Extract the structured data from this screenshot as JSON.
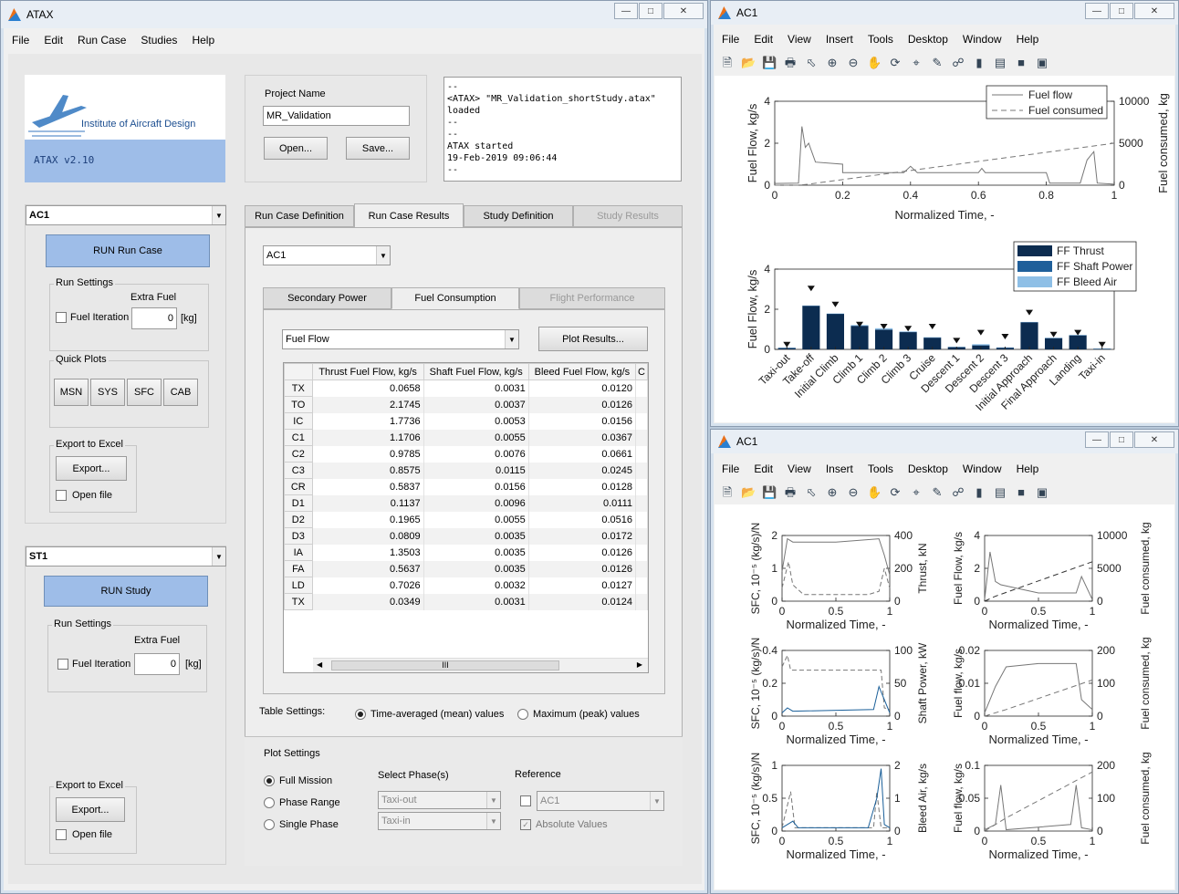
{
  "ataxwin": {
    "title": "ATAX",
    "menu": [
      "File",
      "Edit",
      "Run Case",
      "Studies",
      "Help"
    ],
    "logo_text": "Institute of Aircraft Design",
    "version": "ATAX v2.10",
    "project_label": "Project Name",
    "project_name": "MR_Validation",
    "open_label": "Open...",
    "save_label": "Save...",
    "log": "--\n<ATAX> \"MR_Validation_shortStudy.atax\"\nloaded\n--\n--\nATAX started\n19-Feb-2019 09:06:44\n--",
    "runcase": {
      "select": "AC1",
      "run_label": "RUN Run Case",
      "settings_title": "Run Settings",
      "extra_fuel_label": "Extra Fuel",
      "fuel_iter_label": "Fuel Iteration",
      "extra_fuel_value": "0",
      "unit": "[kg]",
      "quick_title": "Quick Plots",
      "quick": [
        "MSN",
        "SYS",
        "SFC",
        "CAB"
      ],
      "export_title": "Export to Excel",
      "export_label": "Export...",
      "open_file": "Open file"
    },
    "study": {
      "select": "ST1",
      "run_label": "RUN Study",
      "settings_title": "Run Settings",
      "extra_fuel_label": "Extra Fuel",
      "fuel_iter_label": "Fuel Iteration",
      "extra_fuel_value": "0",
      "unit": "[kg]",
      "export_title": "Export to Excel",
      "export_label": "Export...",
      "open_file": "Open file"
    },
    "tabs": [
      "Run Case Definition",
      "Run Case Results",
      "Study Definition",
      "Study Results"
    ],
    "case_select": "AC1",
    "subtabs": [
      "Secondary Power",
      "Fuel Consumption",
      "Flight Performance"
    ],
    "plot_select": "Fuel Flow",
    "plot_results": "Plot Results...",
    "table": {
      "headers": [
        "Thrust Fuel Flow, kg/s",
        "Shaft Fuel Flow, kg/s",
        "Bleed Fuel Flow, kg/s",
        "C"
      ],
      "rows": [
        [
          "TX",
          "0.0658",
          "0.0031",
          "0.0120"
        ],
        [
          "TO",
          "2.1745",
          "0.0037",
          "0.0126"
        ],
        [
          "IC",
          "1.7736",
          "0.0053",
          "0.0156"
        ],
        [
          "C1",
          "1.1706",
          "0.0055",
          "0.0367"
        ],
        [
          "C2",
          "0.9785",
          "0.0076",
          "0.0661"
        ],
        [
          "C3",
          "0.8575",
          "0.0115",
          "0.0245"
        ],
        [
          "CR",
          "0.5837",
          "0.0156",
          "0.0128"
        ],
        [
          "D1",
          "0.1137",
          "0.0096",
          "0.0111"
        ],
        [
          "D2",
          "0.1965",
          "0.0055",
          "0.0516"
        ],
        [
          "D3",
          "0.0809",
          "0.0035",
          "0.0172"
        ],
        [
          "IA",
          "1.3503",
          "0.0035",
          "0.0126"
        ],
        [
          "FA",
          "0.5637",
          "0.0035",
          "0.0126"
        ],
        [
          "LD",
          "0.7026",
          "0.0032",
          "0.0127"
        ],
        [
          "TX",
          "0.0349",
          "0.0031",
          "0.0124"
        ]
      ],
      "hscroll": "III"
    },
    "table_settings": "Table Settings:",
    "ts_mean": "Time-averaged (mean) values",
    "ts_peak": "Maximum (peak) values",
    "plot_settings": "Plot Settings",
    "ps_full": "Full Mission",
    "ps_range": "Phase Range",
    "ps_single": "Single Phase",
    "select_phase": "Select Phase(s)",
    "phase1": "Taxi-out",
    "phase2": "Taxi-in",
    "reference": "Reference",
    "ref_select": "AC1",
    "abs_values": "Absolute Values"
  },
  "fig1": {
    "title": "AC1",
    "menu": [
      "File",
      "Edit",
      "View",
      "Insert",
      "Tools",
      "Desktop",
      "Window",
      "Help"
    ],
    "legend1": [
      "Fuel flow",
      "Fuel consumed"
    ],
    "legend2": [
      "FF Thrust",
      "FF Shaft Power",
      "FF Bleed Air"
    ],
    "ylabel1": "Fuel Flow, kg/s",
    "ylabel1r": "Fuel consumed, kg",
    "xlabel1": "Normalized Time, -",
    "ylabel2": "Fuel Flow, kg/s",
    "xticks": [
      "0",
      "0.2",
      "0.4",
      "0.6",
      "0.8",
      "1"
    ],
    "yticks1": [
      "0",
      "2",
      "4"
    ],
    "yticks1r": [
      "0",
      "5000",
      "10000"
    ],
    "yticks2": [
      "0",
      "2",
      "4"
    ],
    "phases": [
      "Taxi-out",
      "Take-off",
      "Initial Climb",
      "Climb 1",
      "Climb 2",
      "Climb 3",
      "Cruise",
      "Descent 1",
      "Descent 2",
      "Descent 3",
      "Initial Approach",
      "Final Approach",
      "Landing",
      "Taxi-in"
    ],
    "colors": {
      "thrust": "#0c2c50",
      "shaft": "#1f5f9a",
      "bleed": "#8ebfe6"
    }
  },
  "fig2": {
    "title": "AC1",
    "menu": [
      "File",
      "Edit",
      "View",
      "Insert",
      "Tools",
      "Desktop",
      "Window",
      "Help"
    ],
    "xlabel": "Normalized Time, -",
    "xticks": [
      "0",
      "0.5",
      "1"
    ],
    "p1": {
      "yl": "SFC, 10⁻⁵ (kg/s)/N",
      "yr": "Thrust, kN",
      "ylt": [
        "0",
        "1",
        "2"
      ],
      "yrt": [
        "0",
        "200",
        "400"
      ]
    },
    "p2": {
      "yl": "Fuel Flow, kg/s",
      "yr": "Fuel consumed, kg",
      "ylt": [
        "0",
        "2",
        "4"
      ],
      "yrt": [
        "0",
        "5000",
        "10000"
      ]
    },
    "p3": {
      "yl": "SFC, 10⁻⁵ (kg/s)/N",
      "yr": "Shaft Power, kW",
      "ylt": [
        "0",
        "0.2",
        "0.4"
      ],
      "yrt": [
        "0",
        "50",
        "100"
      ]
    },
    "p4": {
      "yl": "Fuel flow, kg/s",
      "yr": "Fuel consumed, kg",
      "ylt": [
        "0",
        "0.01",
        "0.02"
      ],
      "yrt": [
        "0",
        "100",
        "200"
      ]
    },
    "p5": {
      "yl": "SFC, 10⁻⁵ (kg/s)/N",
      "yr": "Bleed Air, kg/s",
      "ylt": [
        "0",
        "0.5",
        "1"
      ],
      "yrt": [
        "0",
        "1",
        "2"
      ]
    },
    "p6": {
      "yl": "Fuel flow, kg/s",
      "yr": "Fuel consumed, kg",
      "ylt": [
        "0",
        "0.05",
        "0.1"
      ],
      "yrt": [
        "0",
        "100",
        "200"
      ]
    }
  },
  "chart_data": [
    {
      "type": "bar",
      "title": "",
      "categories": [
        "Taxi-out",
        "Take-off",
        "Initial Climb",
        "Climb 1",
        "Climb 2",
        "Climb 3",
        "Cruise",
        "Descent 1",
        "Descent 2",
        "Descent 3",
        "Initial Approach",
        "Final Approach",
        "Landing",
        "Taxi-in"
      ],
      "series": [
        {
          "name": "FF Thrust",
          "values": [
            0.07,
            2.17,
            1.77,
            1.17,
            0.98,
            0.86,
            0.58,
            0.11,
            0.2,
            0.08,
            1.35,
            0.56,
            0.7,
            0.03
          ]
        },
        {
          "name": "FF Shaft Power",
          "values": [
            0.003,
            0.004,
            0.005,
            0.006,
            0.008,
            0.012,
            0.016,
            0.01,
            0.006,
            0.004,
            0.004,
            0.004,
            0.003,
            0.003
          ]
        },
        {
          "name": "FF Bleed Air",
          "values": [
            0.012,
            0.013,
            0.016,
            0.037,
            0.066,
            0.025,
            0.013,
            0.011,
            0.052,
            0.017,
            0.013,
            0.013,
            0.013,
            0.012
          ]
        }
      ],
      "peaks": [
        0.1,
        2.9,
        2.1,
        1.1,
        1.0,
        0.9,
        1.0,
        0.3,
        0.7,
        0.5,
        1.7,
        0.6,
        0.7,
        0.1
      ],
      "ylabel": "Fuel Flow, kg/s",
      "ylim": [
        0,
        4
      ]
    },
    {
      "type": "line",
      "xlabel": "Normalized Time, -",
      "ylabel": "Fuel Flow, kg/s",
      "ylabel_right": "Fuel consumed, kg",
      "xlim": [
        0,
        1
      ],
      "ylim": [
        0,
        4
      ],
      "ylim_right": [
        0,
        12000
      ],
      "series": [
        {
          "name": "Fuel flow",
          "x": [
            0,
            0.07,
            0.08,
            0.09,
            0.1,
            0.12,
            0.12,
            0.2,
            0.2,
            0.38,
            0.4,
            0.42,
            0.6,
            0.61,
            0.62,
            0.8,
            0.81,
            0.9,
            0.92,
            0.94,
            0.95,
            1
          ],
          "y": [
            0.08,
            0.1,
            2.8,
            1.8,
            2.0,
            1.1,
            1.1,
            1.0,
            0.6,
            0.6,
            0.9,
            0.6,
            0.6,
            0.8,
            0.6,
            0.6,
            0.1,
            0.1,
            1.2,
            1.6,
            0.1,
            0.05
          ]
        },
        {
          "name": "Fuel consumed",
          "x": [
            0,
            0.07,
            0.1,
            1
          ],
          "y": [
            0,
            0,
            150,
            6000
          ]
        }
      ]
    }
  ]
}
